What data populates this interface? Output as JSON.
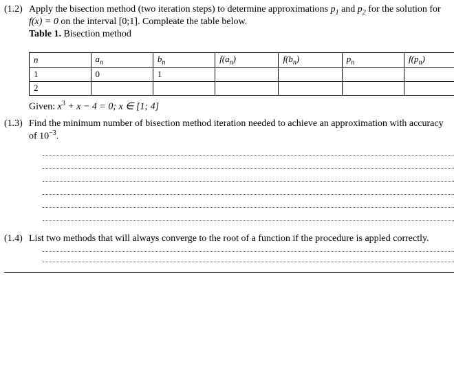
{
  "q12": {
    "num": "(1.2)",
    "text_a": "Apply the bisection method (two iteration steps) to determine approximations ",
    "p1": "p",
    "p1sub": "1",
    "text_b": " and ",
    "p2": "p",
    "p2sub": "2",
    "text_c": " for the solution for ",
    "eq": "f(x) = 0",
    "text_d": " on the interval [0;1]. Compleate the table below.",
    "table_label": "Table 1.",
    "table_caption": " Bisection method"
  },
  "table": {
    "h_n": "n",
    "h_an": "a",
    "h_an_sub": "n",
    "h_bn": "b",
    "h_bn_sub": "n",
    "h_fan": "f(a",
    "h_fan_sub": "n",
    "h_fan_close": ")",
    "h_fbn": "f(b",
    "h_fbn_sub": "n",
    "h_fbn_close": ")",
    "h_pn": "p",
    "h_pn_sub": "n",
    "h_fpn": "f(p",
    "h_fpn_sub": "n",
    "h_fpn_close": ")",
    "r1_n": "1",
    "r1_an": "0",
    "r1_bn": "1",
    "r2_n": "2"
  },
  "given": {
    "label": "Given: ",
    "expr_a": "x",
    "expr_sup": "3",
    "expr_b": " + x − 4 = 0; x ∈ [1; 4]"
  },
  "q13": {
    "num": "(1.3)",
    "text_a": "Find the minimum number of bisection method iteration needed to achieve an approximation with accuracy of 10",
    "sup": "−3",
    "text_b": "."
  },
  "q14": {
    "num": "(1.4)",
    "text": "List two methods that will always converge to the root of a function if the procedure is appled correctly."
  }
}
